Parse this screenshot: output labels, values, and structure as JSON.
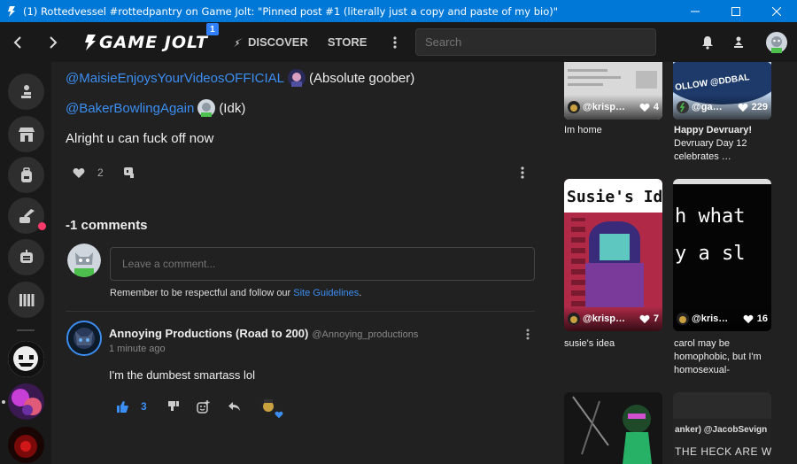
{
  "window": {
    "title": "(1) Rottedvessel #rottedpantry on Game Jolt: \"Pinned post #1 (literally just a copy and paste of my bio)\""
  },
  "nav": {
    "logo_text": "GAME JOLT",
    "notification_badge": "1",
    "discover_label": "DISCOVER",
    "store_label": "STORE",
    "search_placeholder": "Search"
  },
  "post": {
    "lines": [
      {
        "mention": "@MaisieEnjoysYourVideosOFFICIAL",
        "text": "(Absolute goober)"
      },
      {
        "mention": "@BakerBowlingAgain",
        "text": "(Idk)"
      }
    ],
    "closing_text": "Alright u can fuck off now",
    "like_count": "2"
  },
  "comments": {
    "heading": "-1 comments",
    "input_placeholder": "Leave a comment...",
    "guideline_prefix": "Remember to be respectful and follow our ",
    "guideline_link": "Site Guidelines",
    "guideline_suffix": ".",
    "items": [
      {
        "author": "Annoying Productions (Road to 200)",
        "handle": "@Annoying_productions",
        "time": "1 minute ago",
        "body": "I'm the dumbest smartass lol",
        "like_count": "3"
      }
    ]
  },
  "feed": {
    "cards": [
      {
        "user": "@krisp…",
        "likes": "4",
        "caption": "Im home"
      },
      {
        "user": "@ga…",
        "likes": "229",
        "caption": "Happy Devruary!",
        "caption2": "Devruary Day 12 celebrates …",
        "image_text": "OLLOW @DDBAL"
      },
      {
        "user": "@krisp…",
        "likes": "7",
        "caption": "susie's idea",
        "image_text": "Susie's Id"
      },
      {
        "user": "@kris…",
        "likes": "16",
        "caption": "carol may be homophobic, but I'm homosexual-",
        "image_text_1": "h what",
        "image_text_2": "y a sl"
      },
      {
        "user": "",
        "likes": "",
        "caption": ""
      },
      {
        "user": "",
        "likes": "",
        "caption": "",
        "image_text_1": "anker) @JacobSevign",
        "image_text_2": "THE HECK ARE W"
      }
    ]
  },
  "colors": {
    "accent": "#3b8ef3",
    "titlebar": "#0078d7",
    "background": "#212121",
    "nav": "#191919"
  }
}
